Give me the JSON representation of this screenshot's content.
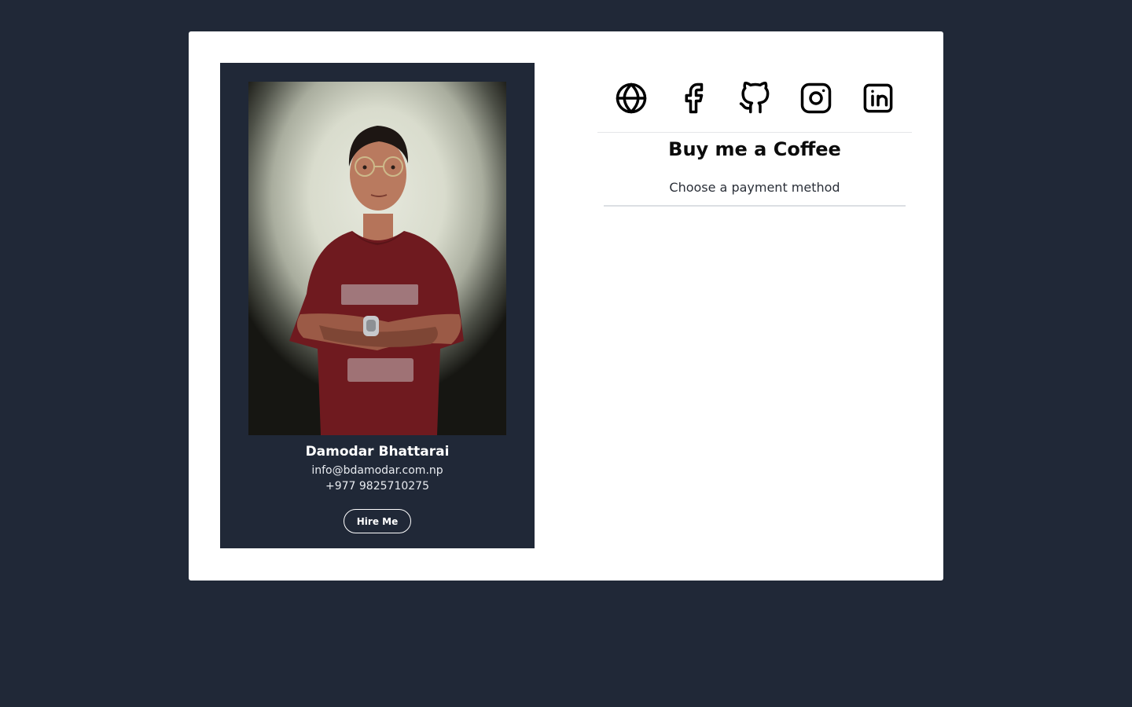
{
  "profile": {
    "name": "Damodar Bhattarai",
    "email": "info@bdamodar.com.np",
    "phone": "+977 9825710275",
    "hire_label": "Hire Me",
    "photo_icon": "profile-photo"
  },
  "social_links": [
    {
      "icon": "globe-icon"
    },
    {
      "icon": "facebook-icon"
    },
    {
      "icon": "github-icon"
    },
    {
      "icon": "instagram-icon"
    },
    {
      "icon": "linkedin-icon"
    }
  ],
  "coffee": {
    "title": "Buy me a Coffee",
    "subtitle": "Choose a payment method"
  },
  "colors": {
    "page_background": "#202837",
    "card_background": "#ffffff",
    "profile_panel": "#202837",
    "shirt": "#6f1a1f"
  }
}
